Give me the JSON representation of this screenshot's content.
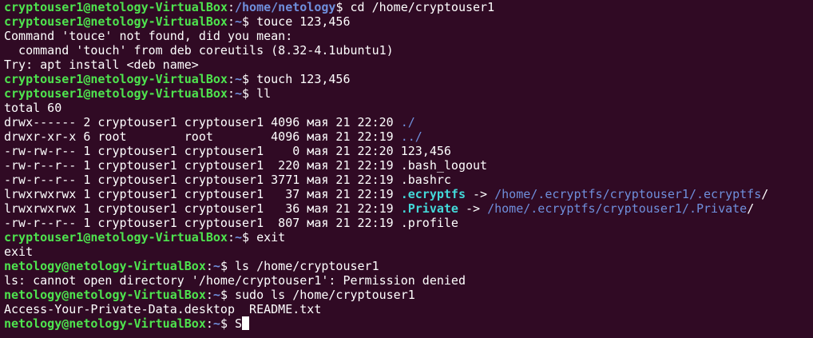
{
  "colors": {
    "background": "#300a24",
    "text": "#ffffff",
    "prompt_user": "#4ee44e",
    "prompt_path": "#6f8fdc",
    "symlink": "#43d9d9",
    "directory": "#6f8fdc"
  },
  "lines": [
    {
      "type": "prompt",
      "user": "cryptouser1@netology-VirtualBox",
      "sep": ":",
      "path": "/home/netology",
      "sym": "$",
      "cmd": " cd /home/cryptouser1"
    },
    {
      "type": "prompt",
      "user": "cryptouser1@netology-VirtualBox",
      "sep": ":",
      "path": "~",
      "sym": "$",
      "cmd": " touce 123,456"
    },
    {
      "type": "output",
      "segments": [
        {
          "t": "Command 'touce' not found, did you mean:"
        }
      ]
    },
    {
      "type": "output",
      "segments": [
        {
          "t": "  command 'touch' from deb coreutils (8.32-4.1ubuntu1)"
        }
      ]
    },
    {
      "type": "output",
      "segments": [
        {
          "t": "Try: apt install <deb name>"
        }
      ]
    },
    {
      "type": "prompt",
      "user": "cryptouser1@netology-VirtualBox",
      "sep": ":",
      "path": "~",
      "sym": "$",
      "cmd": " touch 123,456"
    },
    {
      "type": "prompt",
      "user": "cryptouser1@netology-VirtualBox",
      "sep": ":",
      "path": "~",
      "sym": "$",
      "cmd": " ll"
    },
    {
      "type": "output",
      "segments": [
        {
          "t": "total 60"
        }
      ]
    },
    {
      "type": "output",
      "segments": [
        {
          "t": "drwx------ 2 cryptouser1 cryptouser1 4096 мая 21 22:20 "
        },
        {
          "t": "./",
          "s": "dir"
        }
      ]
    },
    {
      "type": "output",
      "segments": [
        {
          "t": "drwxr-xr-x 6 root        root        4096 мая 21 22:19 "
        },
        {
          "t": "../",
          "s": "dir"
        }
      ]
    },
    {
      "type": "output",
      "segments": [
        {
          "t": "-rw-rw-r-- 1 cryptouser1 cryptouser1    0 мая 21 22:20 123,456"
        }
      ]
    },
    {
      "type": "output",
      "segments": [
        {
          "t": "-rw-r--r-- 1 cryptouser1 cryptouser1  220 мая 21 22:19 .bash_logout"
        }
      ]
    },
    {
      "type": "output",
      "segments": [
        {
          "t": "-rw-r--r-- 1 cryptouser1 cryptouser1 3771 мая 21 22:19 .bashrc"
        }
      ]
    },
    {
      "type": "output",
      "segments": [
        {
          "t": "lrwxrwxrwx 1 cryptouser1 cryptouser1   37 мая 21 22:19 "
        },
        {
          "t": ".ecryptfs",
          "s": "link"
        },
        {
          "t": " -> "
        },
        {
          "t": "/home/.ecryptfs/cryptouser1/.ecryptfs",
          "s": "dir"
        },
        {
          "t": "/"
        }
      ]
    },
    {
      "type": "output",
      "segments": [
        {
          "t": "lrwxrwxrwx 1 cryptouser1 cryptouser1   36 мая 21 22:19 "
        },
        {
          "t": ".Private",
          "s": "link"
        },
        {
          "t": " -> "
        },
        {
          "t": "/home/.ecryptfs/cryptouser1/.Private",
          "s": "dir"
        },
        {
          "t": "/"
        }
      ]
    },
    {
      "type": "output",
      "segments": [
        {
          "t": "-rw-r--r-- 1 cryptouser1 cryptouser1  807 мая 21 22:19 .profile"
        }
      ]
    },
    {
      "type": "prompt",
      "user": "cryptouser1@netology-VirtualBox",
      "sep": ":",
      "path": "~",
      "sym": "$",
      "cmd": " exit"
    },
    {
      "type": "output",
      "segments": [
        {
          "t": "exit"
        }
      ]
    },
    {
      "type": "prompt",
      "user": "netology@netology-VirtualBox",
      "sep": ":",
      "path": "~",
      "sym": "$",
      "cmd": " ls /home/cryptouser1"
    },
    {
      "type": "output",
      "segments": [
        {
          "t": "ls: cannot open directory '/home/cryptouser1': Permission denied"
        }
      ]
    },
    {
      "type": "prompt",
      "user": "netology@netology-VirtualBox",
      "sep": ":",
      "path": "~",
      "sym": "$",
      "cmd": " sudo ls /home/cryptouser1"
    },
    {
      "type": "output",
      "segments": [
        {
          "t": "Access-Your-Private-Data.desktop  README.txt"
        }
      ]
    },
    {
      "type": "prompt",
      "user": "netology@netology-VirtualBox",
      "sep": ":",
      "path": "~",
      "sym": "$",
      "cmd": " S",
      "cursor": true
    }
  ]
}
